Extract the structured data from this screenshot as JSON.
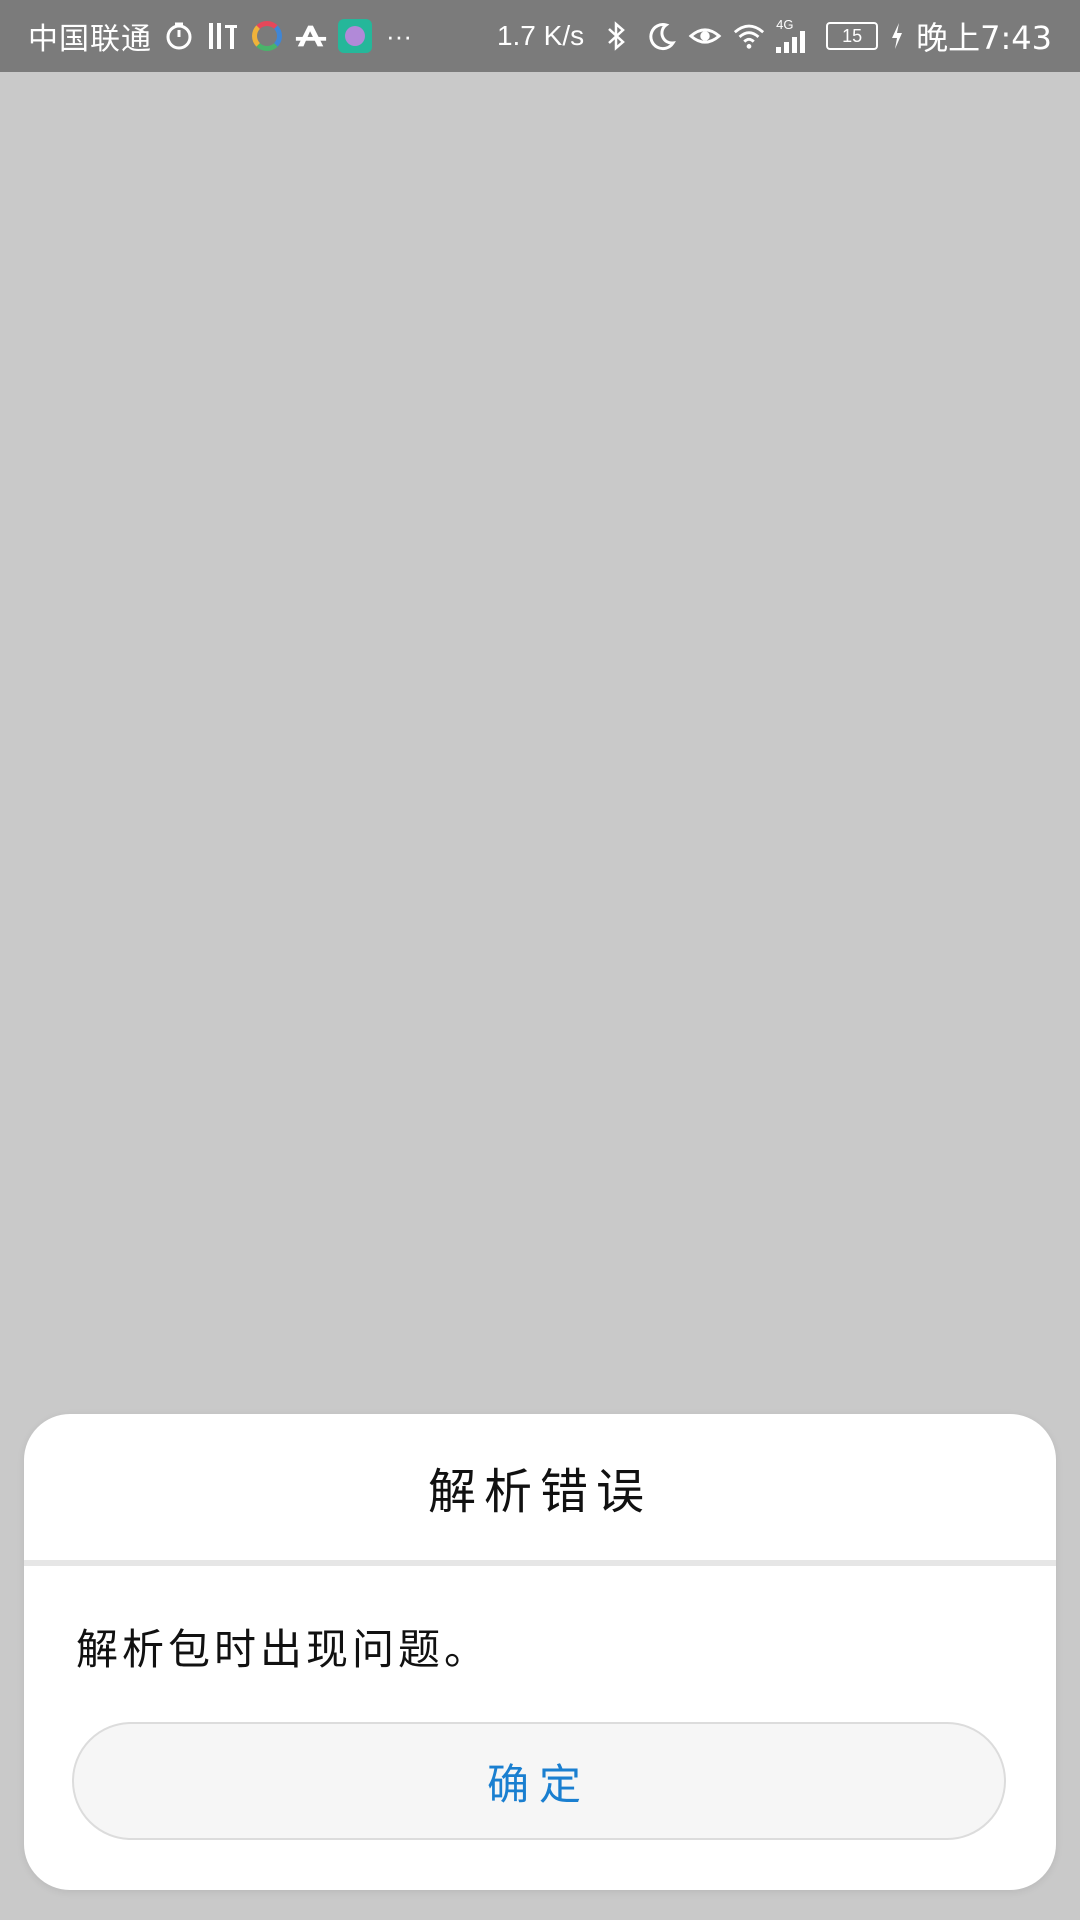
{
  "status_bar": {
    "carrier": "中国联通",
    "network_speed": "1.7 K/s",
    "network_type": "4G",
    "battery_level": "15",
    "time": "晚上7:43",
    "icons": [
      "timer-icon",
      "ting-app-icon",
      "ring-app-icon",
      "font-app-icon",
      "green-app-icon",
      "more-icon",
      "bluetooth-icon",
      "moon-icon",
      "eye-icon",
      "wifi-icon",
      "signal-icon",
      "battery-icon",
      "charging-icon"
    ],
    "more_glyph": "···"
  },
  "dialog": {
    "title": "解析错误",
    "message": "解析包时出现问题。",
    "confirm_label": "确定",
    "accent_color": "#1a7fd0"
  },
  "colors": {
    "background": "#c9c9c9",
    "status_bar": "#7b7b7b",
    "dialog": "#ffffff"
  }
}
